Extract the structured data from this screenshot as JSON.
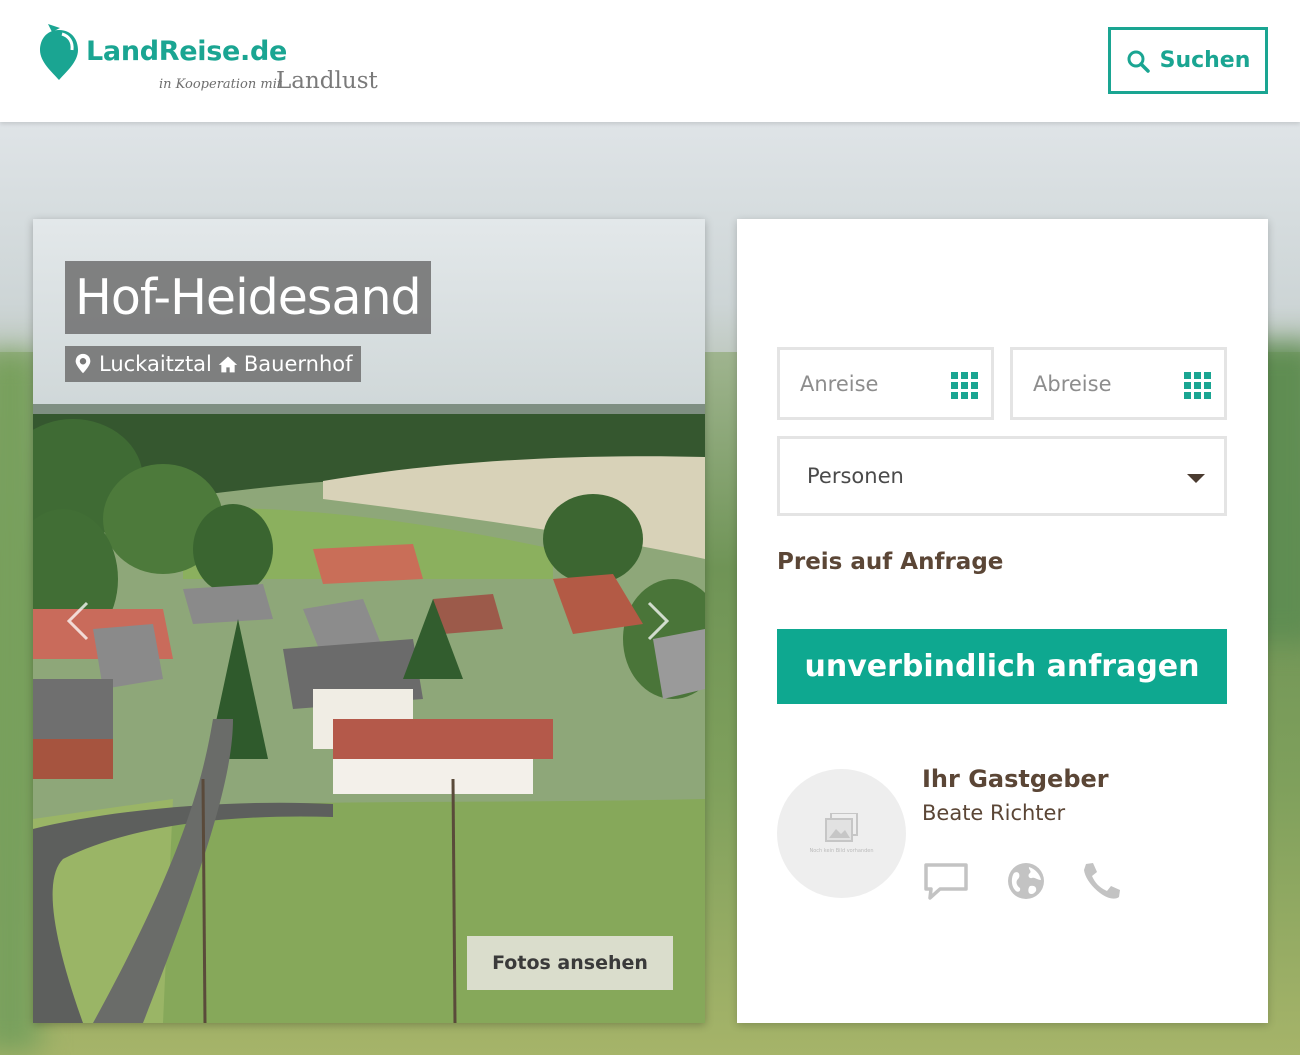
{
  "header": {
    "logo_text": "LandReise.de",
    "logo_sub": "in Kooperation mit",
    "logo_partner": "Landlust",
    "search_label": "Suchen"
  },
  "listing": {
    "title": "Hof-Heidesand",
    "location": "Luckaitztal",
    "category": "Bauernhof",
    "photos_label": "Fotos ansehen"
  },
  "booking": {
    "arrival_placeholder": "Anreise",
    "departure_placeholder": "Abreise",
    "persons_label": "Personen",
    "price_text": "Preis auf Anfrage",
    "request_label": "unverbindlich anfragen"
  },
  "host": {
    "label": "Ihr Gastgeber",
    "name": "Beate Richter",
    "avatar_placeholder": "Noch kein Bild vorhanden"
  },
  "colors": {
    "brand": "#1aa592",
    "cta": "#0ea890",
    "text_brown": "#5b4636"
  },
  "icons": [
    "search-icon",
    "map-pin-icon",
    "home-icon",
    "calendar-icon",
    "chevron-left-icon",
    "chevron-right-icon",
    "message-icon",
    "globe-icon",
    "phone-icon"
  ]
}
